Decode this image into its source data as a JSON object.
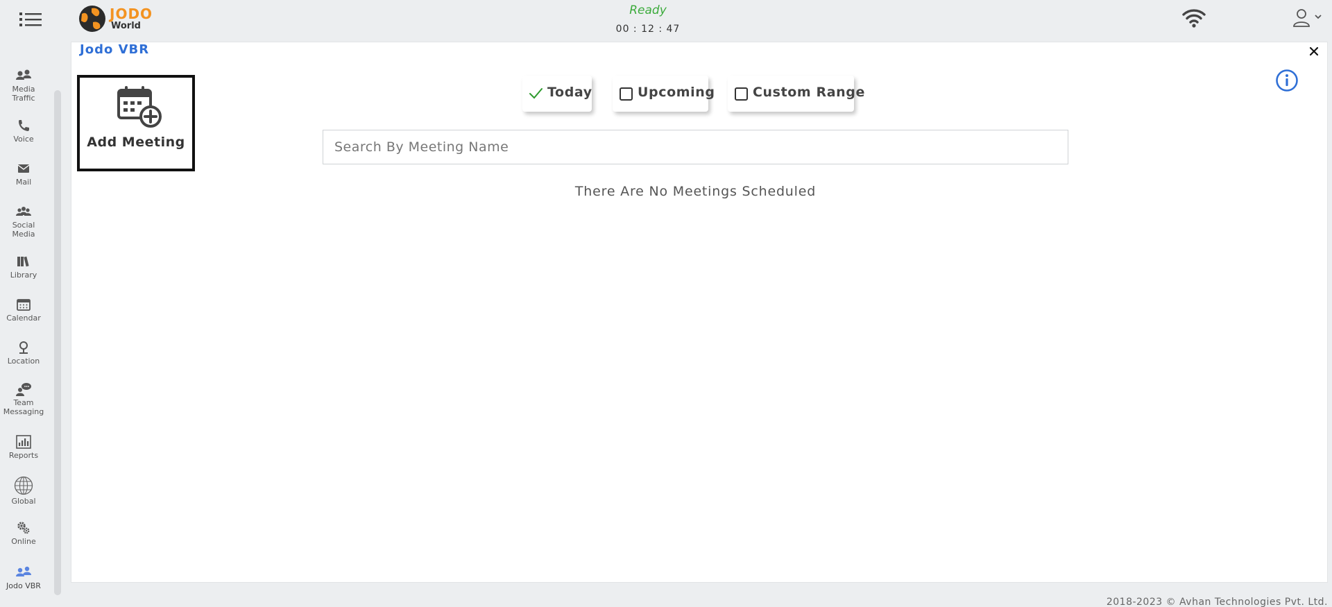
{
  "header": {
    "logo_brand": "JODO",
    "logo_sub": "World",
    "status": "Ready",
    "timer": "00 : 12 : 47"
  },
  "sidebar": {
    "items": [
      {
        "label": "Media Traffic",
        "icon": "media-traffic-icon"
      },
      {
        "label": "Voice",
        "icon": "phone-icon"
      },
      {
        "label": "Mail",
        "icon": "mail-icon"
      },
      {
        "label": "Social Media",
        "icon": "social-media-icon"
      },
      {
        "label": "Library",
        "icon": "library-icon"
      },
      {
        "label": "Calendar",
        "icon": "calendar-icon"
      },
      {
        "label": "Location",
        "icon": "location-icon"
      },
      {
        "label": "Team Messaging",
        "icon": "team-messaging-icon"
      },
      {
        "label": "Reports",
        "icon": "reports-icon"
      },
      {
        "label": "Global",
        "icon": "globe-icon"
      },
      {
        "label": "Online",
        "icon": "gears-icon"
      },
      {
        "label": "Jodo VBR",
        "icon": "jodo-vbr-icon"
      }
    ]
  },
  "panel": {
    "title": "Jodo VBR",
    "add_meeting_label": "Add Meeting",
    "filters": [
      {
        "label": "Today",
        "checked": true
      },
      {
        "label": "Upcoming",
        "checked": false
      },
      {
        "label": "Custom Range",
        "checked": false
      }
    ],
    "search_placeholder": "Search By Meeting Name",
    "empty_message": "There Are No Meetings Scheduled"
  },
  "footer": {
    "copyright": "2018-2023 © Avhan Technologies Pvt. Ltd."
  },
  "colors": {
    "accent_blue": "#2f6fd6",
    "status_green": "#3cab3c",
    "brand_orange": "#f39321",
    "background": "#eceef0"
  }
}
